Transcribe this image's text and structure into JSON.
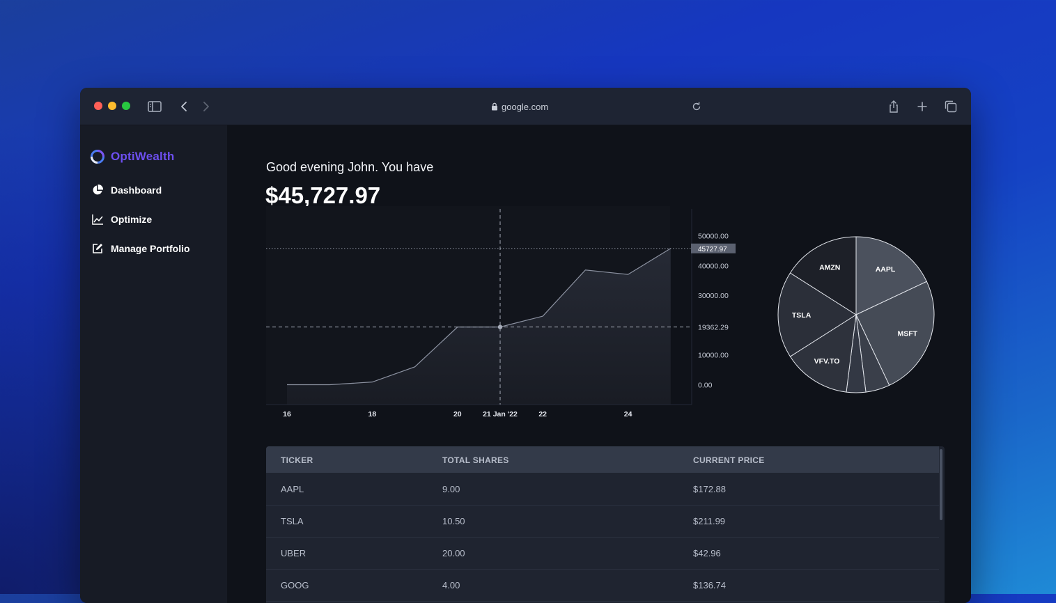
{
  "browser": {
    "url": "google.com",
    "colors": {
      "close": "#ff5f57",
      "minimize": "#febc2e",
      "zoom": "#28c840"
    }
  },
  "sidebar": {
    "brand": "OptiWealth",
    "items": [
      {
        "label": "Dashboard",
        "icon": "pie-chart-icon"
      },
      {
        "label": "Optimize",
        "icon": "line-chart-icon"
      },
      {
        "label": "Manage Portfolio",
        "icon": "edit-icon"
      }
    ]
  },
  "main": {
    "greeting": "Good evening John. You have",
    "balance": "$45,727.97"
  },
  "chart_data": [
    {
      "type": "area",
      "x": [
        "16",
        "17",
        "18",
        "19",
        "20",
        "21",
        "22",
        "23",
        "24",
        "25"
      ],
      "values": [
        0,
        0,
        900,
        6000,
        19362.29,
        19362.29,
        23000,
        38500,
        37000,
        45727.97
      ],
      "x_tick_labels": [
        "16",
        "18",
        "20",
        "21 Jan '22",
        "22",
        "24"
      ],
      "y_tick_labels": [
        "50000.00",
        "40000.00",
        "30000.00",
        "10000.00",
        "0.00"
      ],
      "ylim": [
        0,
        50000
      ],
      "crosshair": {
        "x_label": "21 Jan '22",
        "y_label": "19362.29"
      },
      "current_value_label": "45727.97",
      "grid": false
    },
    {
      "type": "pie",
      "labels": [
        "AAPL",
        "MSFT",
        "",
        "",
        "VFV.TO",
        "TSLA",
        "AMZN"
      ],
      "values": [
        18,
        25,
        5,
        4,
        14,
        18,
        16
      ]
    }
  ],
  "table": {
    "columns": [
      "TICKER",
      "TOTAL SHARES",
      "CURRENT PRICE"
    ],
    "rows": [
      [
        "AAPL",
        "9.00",
        "$172.88"
      ],
      [
        "TSLA",
        "10.50",
        "$211.99"
      ],
      [
        "UBER",
        "20.00",
        "$42.96"
      ],
      [
        "GOOG",
        "4.00",
        "$136.74"
      ]
    ]
  }
}
